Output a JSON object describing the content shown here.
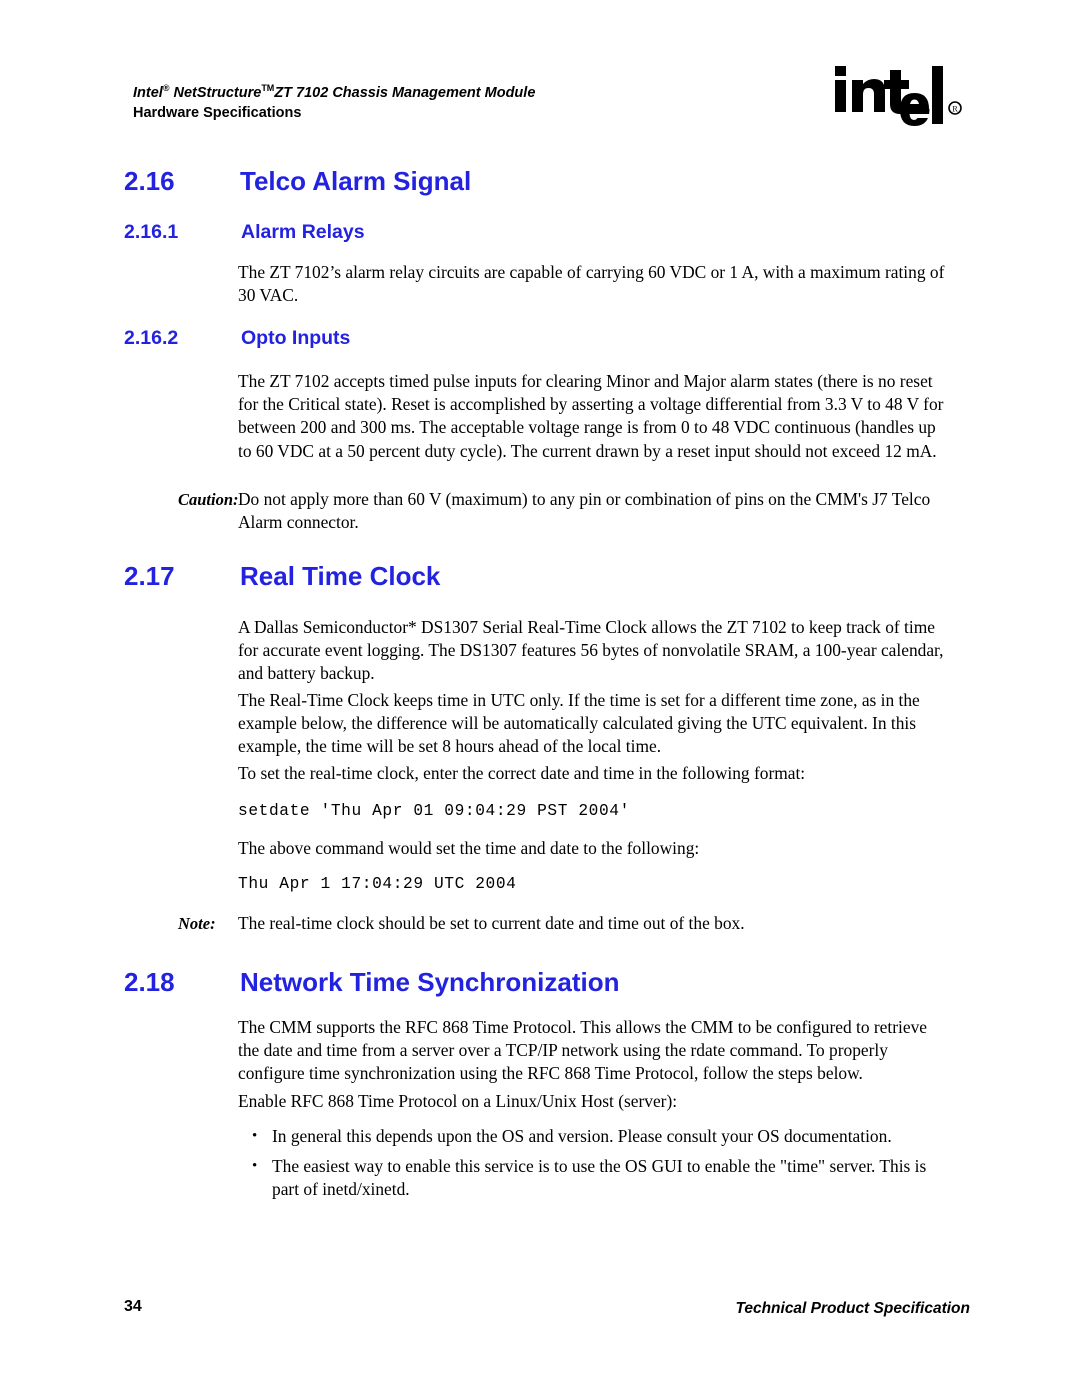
{
  "header": {
    "line1_pre": "Intel",
    "line1_sup1": "®",
    "line1_mid": " NetStructure",
    "line1_sup2": "TM",
    "line1_post": "ZT 7102 Chassis Management Module",
    "line2": "Hardware Specifications",
    "logo_alt": "intel-logo"
  },
  "sections": {
    "s216": {
      "number": "2.16",
      "title": "Telco Alarm Signal"
    },
    "s2161": {
      "number": "2.16.1",
      "title": "Alarm Relays",
      "para1": "The ZT 7102’s alarm relay circuits are capable of carrying 60 VDC or 1 A, with a maximum rating of 30 VAC."
    },
    "s2162": {
      "number": "2.16.2",
      "title": "Opto Inputs",
      "para1": "The ZT 7102 accepts timed pulse inputs for clearing Minor and Major alarm states (there is no reset for the Critical state). Reset is accomplished by asserting a voltage differential from 3.3 V to 48 V for between 200 and 300 ms. The acceptable voltage range is from 0 to 48 VDC continuous (handles up to 60 VDC at a 50 percent duty cycle). The current drawn by a reset input should not exceed 12 mA.",
      "caution_label": "Caution:",
      "caution_text": "Do not apply more than 60 V (maximum) to any pin or combination of pins on the CMM's J7 Telco Alarm connector."
    },
    "s217": {
      "number": "2.17",
      "title": "Real Time Clock",
      "para1": "A Dallas Semiconductor* DS1307 Serial Real-Time Clock allows the ZT 7102 to keep track of time for accurate event logging. The DS1307 features 56 bytes of nonvolatile SRAM, a 100-year calendar, and battery backup.",
      "para2": "The Real-Time Clock keeps time in UTC only. If the time is set for a different time zone, as in the example below, the difference will be automatically calculated giving the UTC equivalent. In this example, the time will be set 8 hours ahead of the local time.",
      "para3": "To set the real-time clock, enter the correct date and time in the following format:",
      "code1": "setdate 'Thu Apr 01 09:04:29 PST 2004'",
      "para4": "The above command would set the time and date to the following:",
      "code2": "Thu Apr 1 17:04:29 UTC 2004",
      "note_label": "Note:",
      "note_text": "The real-time clock should be set to current date and time out of the box."
    },
    "s218": {
      "number": "2.18",
      "title": "Network Time Synchronization",
      "para1": "The CMM supports the RFC 868 Time Protocol. This allows the CMM to be configured to retrieve the date and time from a server over a TCP/IP network using the rdate command. To properly configure time synchronization using the RFC 868 Time Protocol, follow the steps below.",
      "para2": "Enable RFC 868 Time Protocol on a Linux/Unix Host (server):",
      "bullets": [
        "In general this depends upon the OS and version.  Please consult your OS documentation.",
        "The easiest way to enable this service is to use the OS GUI to enable the \"time\" server.  This is part of inetd/xinetd."
      ],
      "bullet_glyph": "•"
    }
  },
  "footer": {
    "page_number": "34",
    "doc_type": "Technical Product Specification"
  },
  "colors": {
    "heading_blue": "#2222e0",
    "body_black": "#000000",
    "page_background": "#ffffff"
  }
}
